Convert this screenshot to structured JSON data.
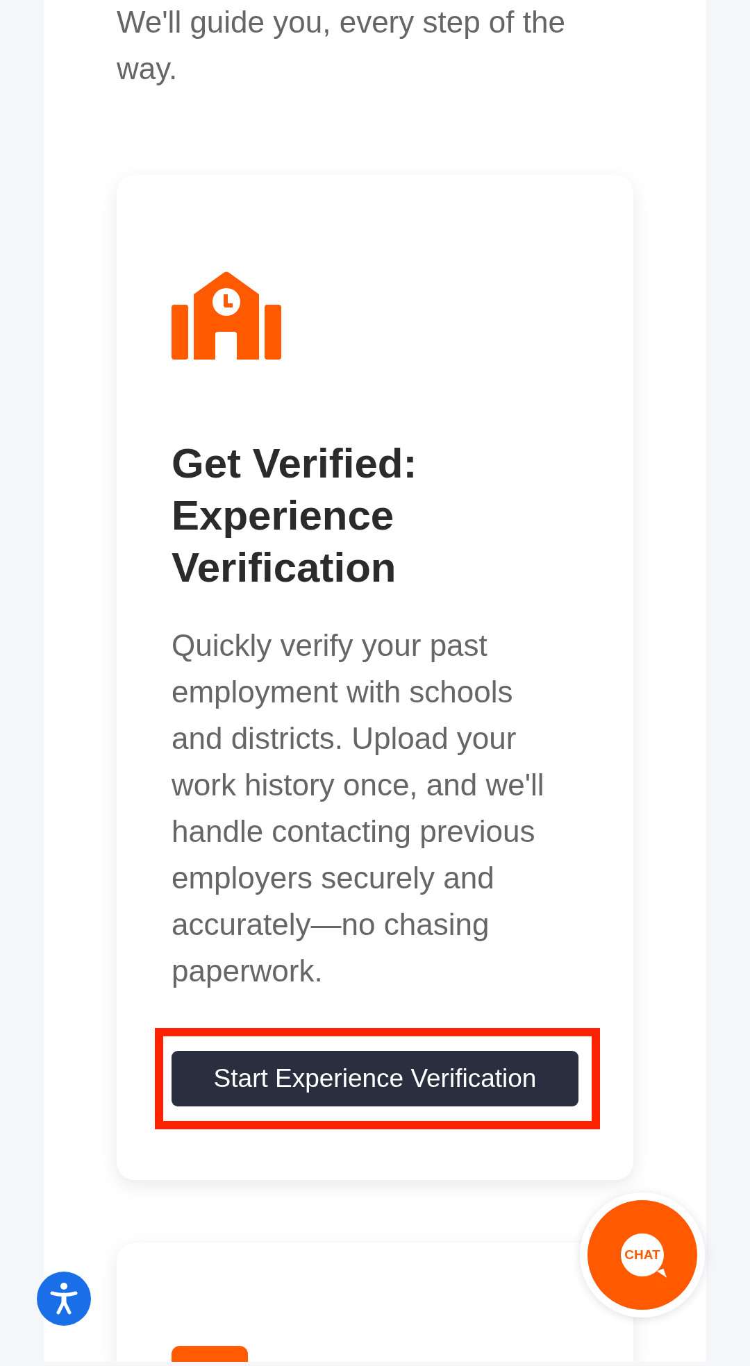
{
  "intro": {
    "text": "We'll guide you, every step of the way."
  },
  "cards": [
    {
      "kind": "feature",
      "title": "Get Verified: Experience Verification",
      "description": "Quickly verify your past employment with schools and districts. Upload your work history once, and we'll handle contacting previous employers securely and accurately—no chasing paperwork.",
      "button": {
        "label": "Start Experience Verification",
        "highlighted": true
      }
    },
    {
      "kind": "feature"
    }
  ],
  "chat_button": {
    "label": "CHAT"
  }
}
